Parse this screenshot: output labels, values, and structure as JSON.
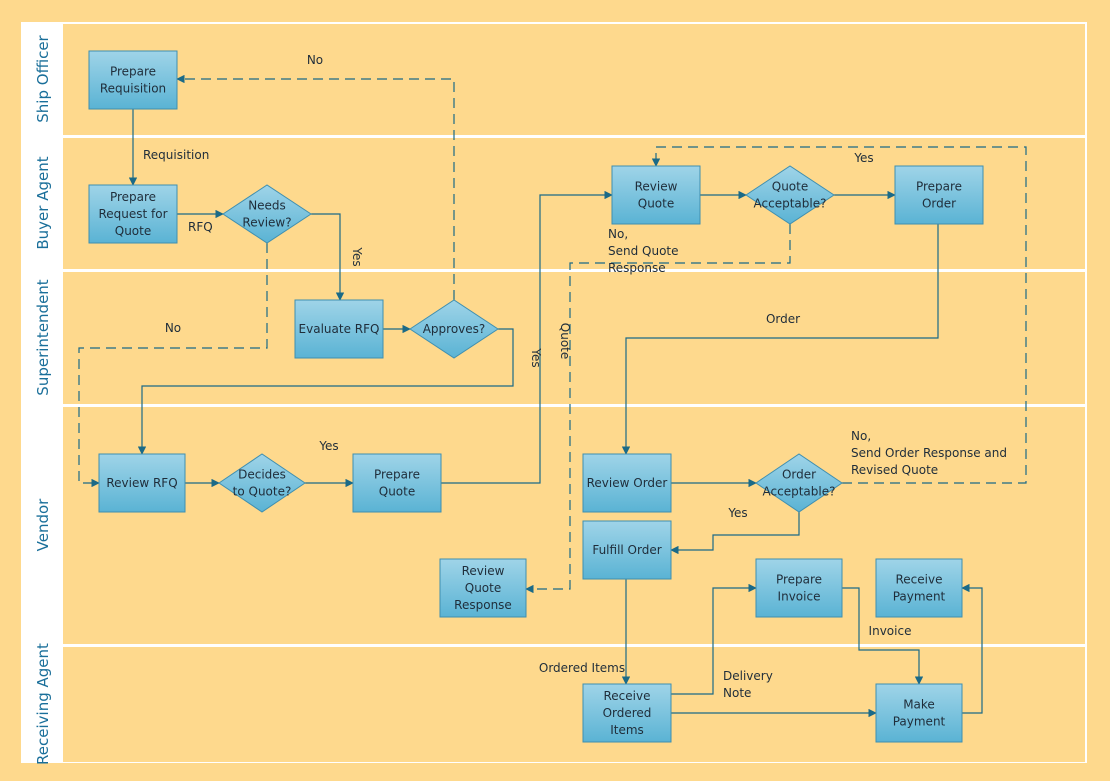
{
  "diagram": {
    "type": "cross-functional flowchart",
    "colors": {
      "background": "#fed98d",
      "lane_fill": "#fed98d",
      "lane_border": "#ffffff",
      "header_fill": "#ffffff",
      "header_text": "#1a6f9a",
      "node_fill_top": "#9fd4e8",
      "node_fill_bottom": "#5ab3d4",
      "node_border": "#3f8fb0",
      "connector": "#1b6a87"
    },
    "lanes": [
      {
        "id": "ship-officer",
        "label": "Ship Officer"
      },
      {
        "id": "buyer-agent",
        "label": "Buyer Agent"
      },
      {
        "id": "superintendent",
        "label": "Superintendent"
      },
      {
        "id": "vendor",
        "label": "Vendor"
      },
      {
        "id": "receiving-agent",
        "label": "Receiving Agent"
      }
    ],
    "nodes": [
      {
        "id": "prepare-requisition",
        "shape": "process",
        "lane": "ship-officer",
        "lines": [
          "Prepare",
          "Requisition"
        ]
      },
      {
        "id": "prepare-rfq",
        "shape": "process",
        "lane": "buyer-agent",
        "lines": [
          "Prepare",
          "Request for",
          "Quote"
        ]
      },
      {
        "id": "needs-review",
        "shape": "decision",
        "lane": "buyer-agent",
        "lines": [
          "Needs",
          "Review?"
        ]
      },
      {
        "id": "review-quote",
        "shape": "process",
        "lane": "buyer-agent",
        "lines": [
          "Review",
          "Quote"
        ]
      },
      {
        "id": "quote-acceptable",
        "shape": "decision",
        "lane": "buyer-agent",
        "lines": [
          "Quote",
          "Acceptable?"
        ]
      },
      {
        "id": "prepare-order",
        "shape": "process",
        "lane": "buyer-agent",
        "lines": [
          "Prepare",
          "Order"
        ]
      },
      {
        "id": "evaluate-rfq",
        "shape": "process",
        "lane": "superintendent",
        "lines": [
          "Evaluate RFQ"
        ]
      },
      {
        "id": "approves",
        "shape": "decision",
        "lane": "superintendent",
        "lines": [
          "Approves?"
        ]
      },
      {
        "id": "review-rfq",
        "shape": "process",
        "lane": "vendor",
        "lines": [
          "Review RFQ"
        ]
      },
      {
        "id": "decides-to-quote",
        "shape": "decision",
        "lane": "vendor",
        "lines": [
          "Decides",
          "to Quote?"
        ]
      },
      {
        "id": "prepare-quote",
        "shape": "process",
        "lane": "vendor",
        "lines": [
          "Prepare",
          "Quote"
        ]
      },
      {
        "id": "review-order",
        "shape": "process",
        "lane": "vendor",
        "lines": [
          "Review Order"
        ]
      },
      {
        "id": "order-acceptable",
        "shape": "decision",
        "lane": "vendor",
        "lines": [
          "Order",
          "Acceptable?"
        ]
      },
      {
        "id": "fulfill-order",
        "shape": "process",
        "lane": "vendor",
        "lines": [
          "Fulfill Order"
        ]
      },
      {
        "id": "review-quote-response",
        "shape": "process",
        "lane": "vendor",
        "lines": [
          "Review",
          "Quote",
          "Response"
        ]
      },
      {
        "id": "prepare-invoice",
        "shape": "process",
        "lane": "vendor",
        "lines": [
          "Prepare",
          "Invoice"
        ]
      },
      {
        "id": "receive-payment",
        "shape": "process",
        "lane": "vendor",
        "lines": [
          "Receive",
          "Payment"
        ]
      },
      {
        "id": "receive-ordered-items",
        "shape": "process",
        "lane": "receiving-agent",
        "lines": [
          "Receive",
          "Ordered",
          "Items"
        ]
      },
      {
        "id": "make-payment",
        "shape": "process",
        "lane": "receiving-agent",
        "lines": [
          "Make",
          "Payment"
        ]
      }
    ],
    "edges": [
      {
        "id": "e1",
        "from": "prepare-requisition",
        "to": "prepare-rfq",
        "style": "solid",
        "label": [
          "Requisition"
        ]
      },
      {
        "id": "e2",
        "from": "prepare-rfq",
        "to": "needs-review",
        "style": "solid",
        "label": [
          "RFQ"
        ]
      },
      {
        "id": "e3",
        "from": "needs-review",
        "to": "evaluate-rfq",
        "style": "solid",
        "label": [
          "Yes"
        ]
      },
      {
        "id": "e4",
        "from": "needs-review",
        "to": "review-rfq",
        "style": "dashed",
        "label": [
          "No"
        ]
      },
      {
        "id": "e5",
        "from": "evaluate-rfq",
        "to": "approves",
        "style": "solid",
        "label": []
      },
      {
        "id": "e6",
        "from": "approves",
        "to": "prepare-requisition",
        "style": "dashed",
        "label": [
          "No"
        ]
      },
      {
        "id": "e7",
        "from": "approves",
        "to": "review-rfq",
        "style": "solid",
        "label": [
          "Yes"
        ]
      },
      {
        "id": "e8",
        "from": "review-rfq",
        "to": "decides-to-quote",
        "style": "solid",
        "label": []
      },
      {
        "id": "e9",
        "from": "decides-to-quote",
        "to": "prepare-quote",
        "style": "solid",
        "label": [
          "Yes"
        ]
      },
      {
        "id": "e10",
        "from": "prepare-quote",
        "to": "review-quote",
        "style": "solid",
        "label": [
          "Quote"
        ]
      },
      {
        "id": "e11",
        "from": "review-quote",
        "to": "quote-acceptable",
        "style": "solid",
        "label": []
      },
      {
        "id": "e12",
        "from": "quote-acceptable",
        "to": "prepare-order",
        "style": "solid",
        "label": []
      },
      {
        "id": "e13",
        "from": "quote-acceptable",
        "to": "review-quote-response",
        "style": "dashed",
        "label": [
          "No,",
          "Send Quote",
          "Response"
        ]
      },
      {
        "id": "e14",
        "from": "prepare-order",
        "to": "review-order",
        "style": "solid",
        "label": [
          "Order"
        ]
      },
      {
        "id": "e15",
        "from": "review-order",
        "to": "order-acceptable",
        "style": "solid",
        "label": []
      },
      {
        "id": "e16",
        "from": "order-acceptable",
        "to": "review-quote",
        "style": "dashed",
        "label": [
          "No,",
          "Send Order Response and",
          "Revised Quote"
        ]
      },
      {
        "id": "e17",
        "from": "order-acceptable",
        "to": "fulfill-order",
        "style": "solid",
        "label": [
          "Yes"
        ]
      },
      {
        "id": "e18",
        "from": "fulfill-order",
        "to": "receive-ordered-items",
        "style": "solid",
        "label": [
          "Ordered Items"
        ]
      },
      {
        "id": "e19",
        "from": "receive-ordered-items",
        "to": "prepare-invoice",
        "style": "solid",
        "label": [
          "Delivery",
          "Note"
        ]
      },
      {
        "id": "e20",
        "from": "receive-ordered-items",
        "to": "make-payment",
        "style": "solid",
        "label": []
      },
      {
        "id": "e21",
        "from": "prepare-invoice",
        "to": "make-payment",
        "style": "solid",
        "label": [
          "Invoice"
        ]
      },
      {
        "id": "e22",
        "from": "make-payment",
        "to": "receive-payment",
        "style": "solid",
        "label": []
      },
      {
        "id": "e23",
        "from": "quote-acceptable",
        "to": "review-quote",
        "style": "dashed-top",
        "label": [
          "Yes"
        ],
        "note": "Yes label above Prepare Order path"
      }
    ]
  }
}
